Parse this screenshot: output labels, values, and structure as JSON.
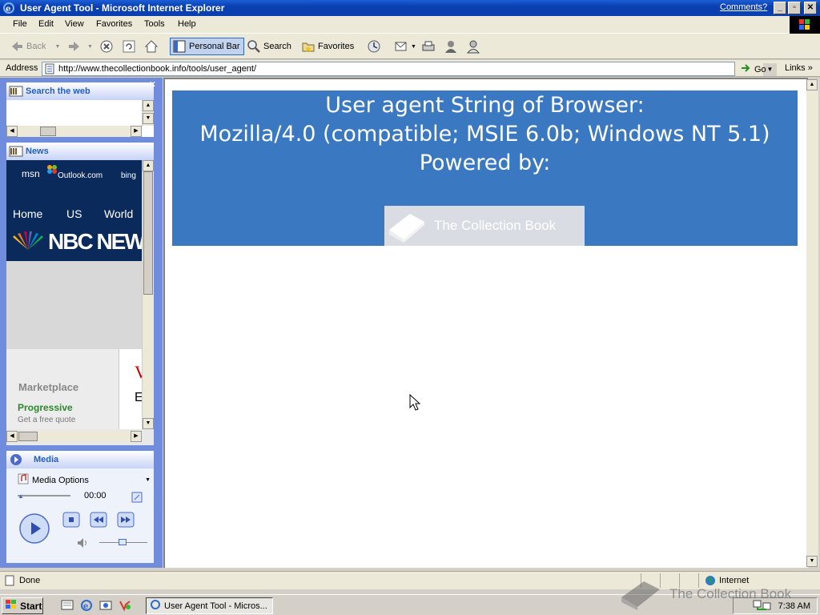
{
  "window": {
    "title": "User Agent Tool - Microsoft Internet Explorer",
    "comments_link": "Comments?"
  },
  "menu": [
    "File",
    "Edit",
    "View",
    "Favorites",
    "Tools",
    "Help"
  ],
  "toolbar": {
    "back": "Back",
    "personal_bar": "Personal Bar",
    "search": "Search",
    "favorites": "Favorites"
  },
  "address": {
    "label": "Address",
    "url": "http://www.thecollectionbook.info/tools/user_agent/",
    "go": "Go",
    "links": "Links"
  },
  "panel": {
    "search_title": "Search the web",
    "news_title": "News",
    "news": {
      "msn": "msn",
      "outlook": "Outlook.com",
      "bing": "bing",
      "nav": [
        "Home",
        "US",
        "World"
      ],
      "nbc": "NBC NEW",
      "marketplace": "Marketplace",
      "ad_title": "Progressive",
      "ad_sub": "Get a free quote",
      "ad_side_1": "V",
      "ad_side_2": "E"
    },
    "media_title": "Media",
    "media_options": "Media Options",
    "media_time": "00:00"
  },
  "page": {
    "line1": "User agent String of Browser:",
    "line2": "Mozilla/4.0 (compatible; MSIE 6.0b; Windows NT 5.1)",
    "line3": "Powered by:",
    "logo_text": "The Collection Book"
  },
  "status": {
    "text": "Done",
    "zone": "Internet"
  },
  "taskbar": {
    "start": "Start",
    "task": "User Agent Tool - Micros...",
    "clock": "7:38 AM"
  },
  "watermark": "The Collection Book",
  "colors": {
    "banner": "#3a78c2",
    "titlebar": "#0a3fb0",
    "panel_bg": "#6f8ddc",
    "link_blue": "#215dc6",
    "ad_green": "#2a8a2a"
  }
}
